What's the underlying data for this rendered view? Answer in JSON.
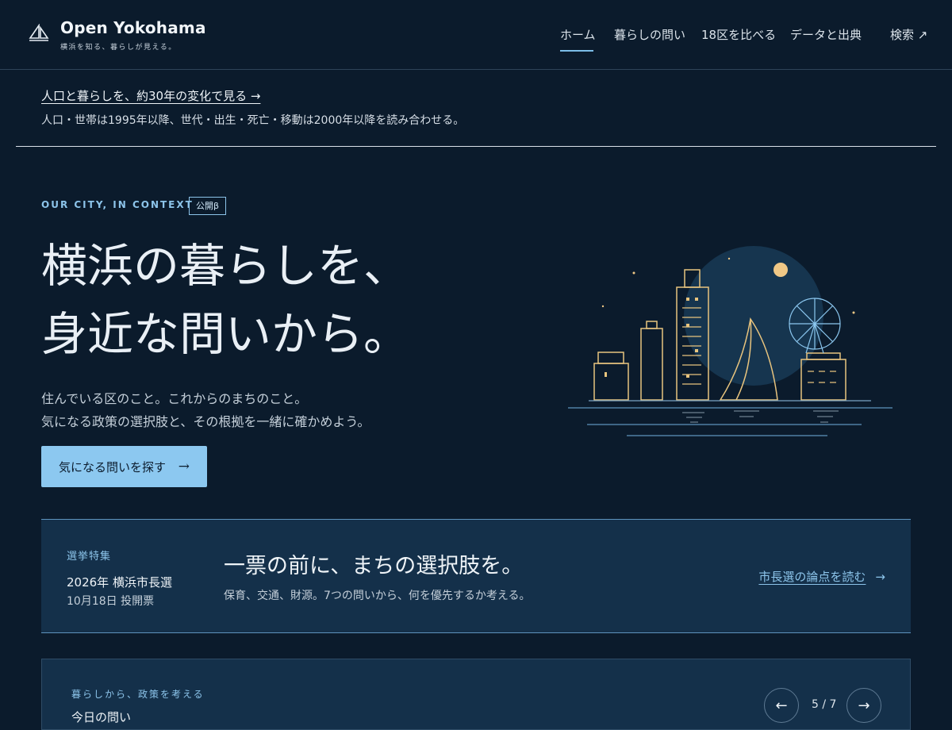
{
  "header": {
    "brand": "Open Yokohama",
    "tagline": "横浜を知る、暮らしが見える。",
    "nav": [
      {
        "label": "ホーム"
      },
      {
        "label": "暮らしの問い"
      },
      {
        "label": "18区を比べる"
      },
      {
        "label": "データと出典"
      },
      {
        "label": "検索 ↗"
      }
    ]
  },
  "notice": {
    "link_label": "人口と暮らしを、約30年の変化で見る →",
    "sub": "人口・世帯は1995年以降、世代・出生・死亡・移動は2000年以降を読み合わせる。"
  },
  "hero": {
    "eyebrow": "OUR CITY, IN CONTEXT",
    "badge": "公開β",
    "title_line1": "横浜の暮らしを、",
    "title_line2": "身近な問いから。",
    "desc_line1": "住んでいる区のこと。これからのまちのこと。",
    "desc_line2": "気になる政策の選択肢と、その根拠を一緒に確かめよう。",
    "cta_label": "気になる問いを探す",
    "cta_arrow": "→"
  },
  "election": {
    "label": "選挙特集",
    "year": "2026年 横浜市長選",
    "date": "10月18日 投開票",
    "heading": "一票の前に、まちの選択肢を。",
    "sub": "保育、交通、財源。7つの問いから、何を優先するか考える。",
    "link_label": "市長選の論点を読む",
    "link_arrow": "→"
  },
  "question_card": {
    "label": "暮らしから、政策を考える",
    "title": "今日の問い",
    "prev": "←",
    "next": "→",
    "page_count": "5 / 7"
  },
  "colors": {
    "background": "#0b1b2c",
    "accent": "#8cc8f0",
    "card": "#14304a",
    "illustration_gold": "#e8c47e"
  },
  "icons": [
    "sailboat-logo-icon",
    "arrow-right-icon",
    "arrow-left-icon",
    "external-link-icon"
  ]
}
